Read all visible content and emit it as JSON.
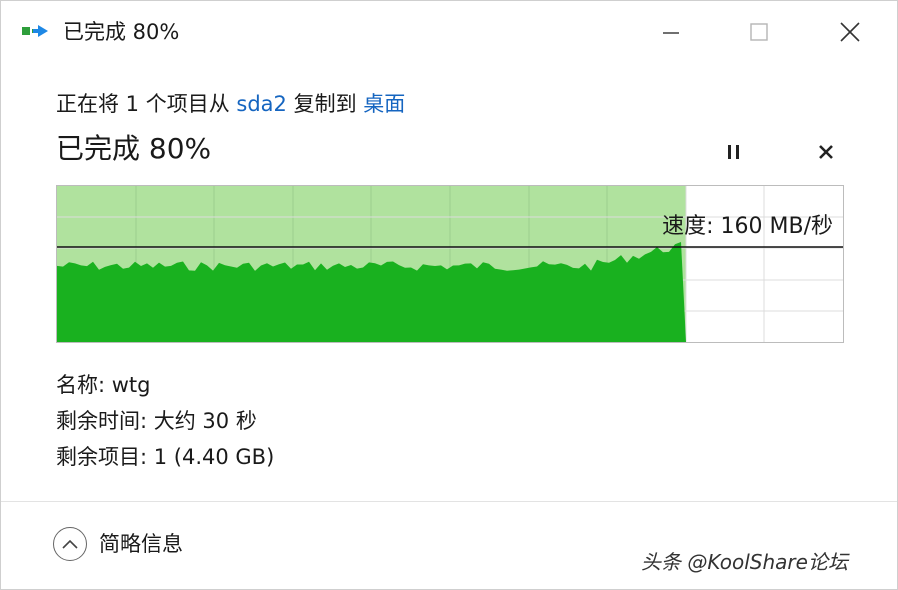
{
  "window": {
    "title": "已完成 80%",
    "controls": {
      "minimize": "minimize-icon",
      "maximize": "maximize-icon",
      "close": "close-icon"
    }
  },
  "copy": {
    "prefix": "正在将 1 个项目从 ",
    "source": "sda2",
    "middle": " 复制到 ",
    "destination": "桌面"
  },
  "progress": {
    "title": "已完成 80%",
    "percent": 80,
    "speed_text": "速度: 160 MB/秒",
    "buttons": {
      "pause": "pause-icon",
      "cancel": "cancel-icon"
    }
  },
  "details": {
    "name": "名称: wtg",
    "time_remaining": "剩余时间: 大约 30 秒",
    "items_remaining": "剩余项目: 1 (4.40 GB)"
  },
  "footer": {
    "toggle_label": "简略信息",
    "toggle_icon": "chevron-up-icon"
  },
  "watermark": "头条 @KoolShare论坛",
  "colors": {
    "fill_light": "#b0e29e",
    "fill_dark": "#19b11f",
    "link": "#1565c0",
    "grid": "#9ccf8e"
  }
}
